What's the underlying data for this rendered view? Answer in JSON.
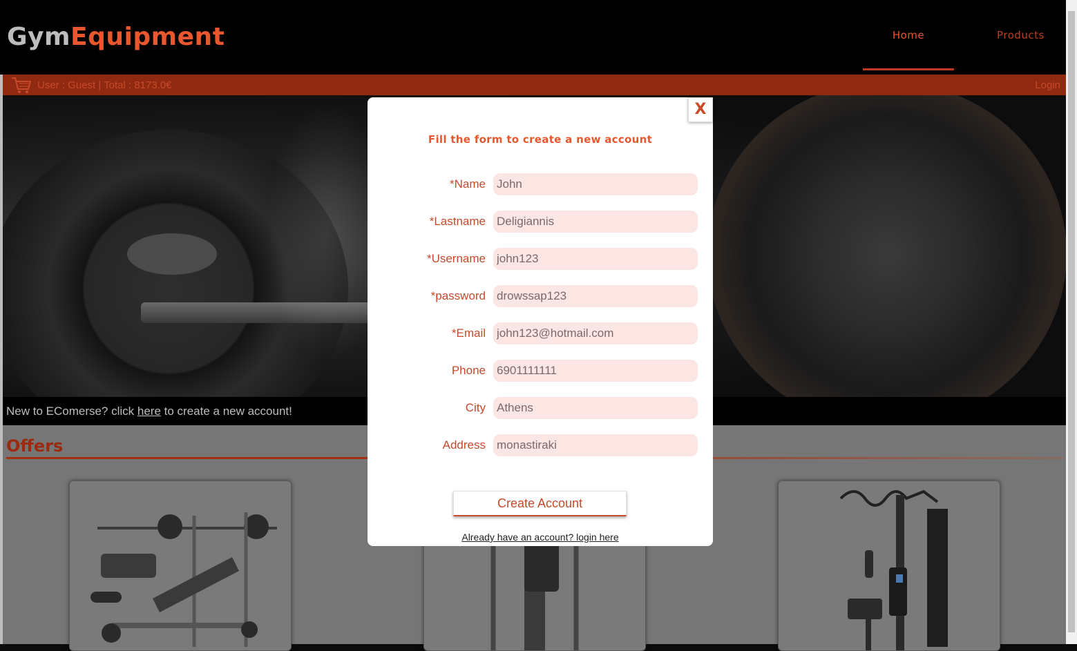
{
  "header": {
    "logo_part1": "Gym",
    "logo_part2": "Equipment",
    "nav": {
      "home": "Home",
      "products": "Products"
    }
  },
  "userbar": {
    "user_info": "User : Guest | Total : 8173.0€",
    "login": "Login"
  },
  "newbar": {
    "prefix": "New to EComerse? click ",
    "link": "here",
    "suffix": " to create a new account!"
  },
  "offers": {
    "title": "Offers"
  },
  "modal": {
    "close": "X",
    "title": "Fill the form to create a new account",
    "fields": [
      {
        "label": "*Name",
        "value": "John"
      },
      {
        "label": "*Lastname",
        "value": "Deligiannis"
      },
      {
        "label": "*Username",
        "value": "john123"
      },
      {
        "label": "*password",
        "value": "drowssap123"
      },
      {
        "label": "*Email",
        "value": "john123@hotmail.com"
      },
      {
        "label": "Phone",
        "value": "6901111111"
      },
      {
        "label": "City",
        "value": "Athens"
      },
      {
        "label": "Address",
        "value": "monastiraki"
      }
    ],
    "submit": "Create Account",
    "login_link": "Already have an account? login here"
  },
  "colors": {
    "accent": "#e8572e",
    "dark_accent": "#8f2a10",
    "input_bg": "#fbe6e3"
  }
}
